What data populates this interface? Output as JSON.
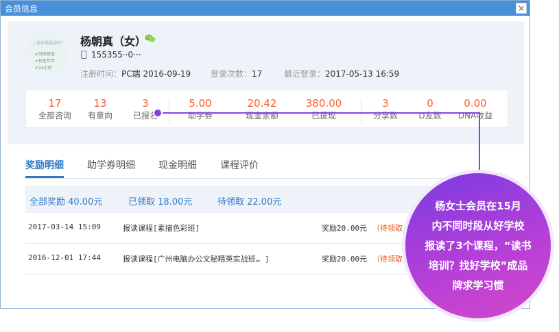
{
  "window": {
    "title": "会员信息",
    "close_symbol": "×"
  },
  "profile": {
    "name": "杨朝真（女）",
    "phone": "155355··0···",
    "register_label": "注册时间：",
    "register_value": "PC端 2016-09-19",
    "login_count_label": "登录次数：",
    "login_count_value": "17",
    "last_login_label": "最近登录：",
    "last_login_value": "2017-05-13 16:59"
  },
  "avatar_text": [
    "上报有需要服务？",
    "✔时尚研金",
    "✔长生年年",
    "✔24小时"
  ],
  "stats": [
    {
      "value": "17",
      "label": "全部咨询"
    },
    {
      "value": "13",
      "label": "有意向"
    },
    {
      "value": "3",
      "label": "已报名"
    },
    {
      "value": "5.00",
      "label": "助学券"
    },
    {
      "value": "20.42",
      "label": "现金余额"
    },
    {
      "value": "380.00",
      "label": "已提现"
    },
    {
      "value": "3",
      "label": "分享数"
    },
    {
      "value": "0",
      "label": "D友数"
    },
    {
      "value": "0.00",
      "label": "DNA收益"
    }
  ],
  "tabs": [
    {
      "label": "奖励明细",
      "active": true
    },
    {
      "label": "助学券明细",
      "active": false
    },
    {
      "label": "现金明细",
      "active": false
    },
    {
      "label": "课程评价",
      "active": false
    }
  ],
  "summary": {
    "total": "全部奖励 40.00元",
    "received": "已领取 18.00元",
    "pending": "待领取 22.00元"
  },
  "rows": [
    {
      "time": "2017-03-14 15:09",
      "desc": "报读课程[素描色彩班]",
      "amount": "奖励20.00元",
      "status": "（待领取"
    },
    {
      "time": "2016-12-01 17:44",
      "desc": "报读课程[广州电脑办公文秘精英实战班… ]",
      "amount": "奖励20.00元",
      "status": "（待领取"
    }
  ],
  "callout": {
    "lines": [
      "杨女士会员在15月",
      "内不同时段从好学校",
      "报读了3个课程，“读书",
      "培训？找好学校”成品",
      "牌求学习惯"
    ]
  },
  "colors": {
    "titlebar": "#4a90d9",
    "accent": "#2e77c8",
    "stat_value": "#ff5a2a",
    "callout_purple": "#8b3fe0"
  }
}
